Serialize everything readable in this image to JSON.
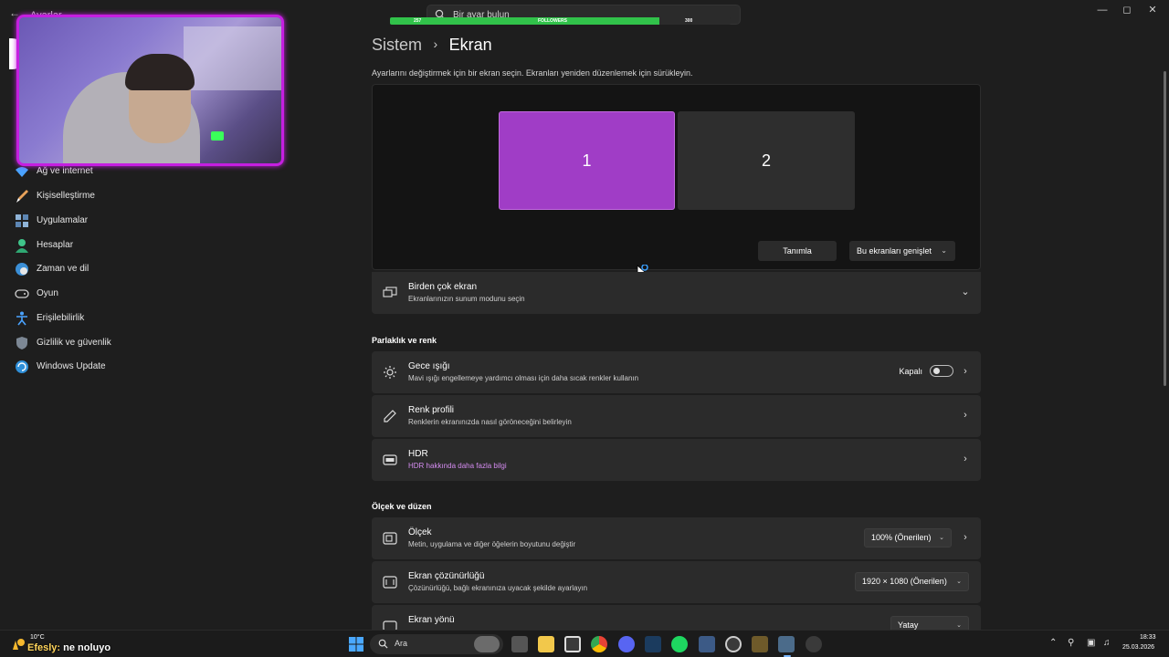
{
  "window": {
    "app_title": "Ayarlar",
    "search_placeholder": "Bir ayar bulun",
    "controls": {
      "minimize": "—",
      "maximize": "◻",
      "close": "✕"
    }
  },
  "follower_goal": {
    "current": "257",
    "label": "FOLLOWERS",
    "goal": "300",
    "progress": 0.79
  },
  "sidebar": {
    "items": [
      {
        "label": "Ağ ve internet",
        "icon": "wifi-icon"
      },
      {
        "label": "Kişiselleştirme",
        "icon": "brush-icon"
      },
      {
        "label": "Uygulamalar",
        "icon": "apps-icon"
      },
      {
        "label": "Hesaplar",
        "icon": "person-icon"
      },
      {
        "label": "Zaman ve dil",
        "icon": "globe-clock-icon"
      },
      {
        "label": "Oyun",
        "icon": "gamepad-icon"
      },
      {
        "label": "Erişilebilirlik",
        "icon": "accessibility-icon"
      },
      {
        "label": "Gizlilik ve güvenlik",
        "icon": "shield-icon"
      },
      {
        "label": "Windows Update",
        "icon": "update-icon"
      }
    ]
  },
  "main": {
    "breadcrumb_parent": "Sistem",
    "breadcrumb_sep": "›",
    "breadcrumb_current": "Ekran",
    "hint": "Ayarlarını değiştirmek için bir ekran seçin. Ekranları yeniden düzenlemek için sürükleyin.",
    "monitors": [
      "1",
      "2"
    ],
    "identify_label": "Tanımla",
    "extend_label": "Bu ekranları genişlet",
    "multiple_displays": {
      "title": "Birden çok ekran",
      "subtitle": "Ekranlarınızın sunum modunu seçin"
    },
    "section_brightness": "Parlaklık ve renk",
    "night_light": {
      "title": "Gece ışığı",
      "subtitle": "Mavi ışığı engellemeye yardımcı olması için daha sıcak renkler kullanın",
      "state": "Kapalı"
    },
    "color_profile": {
      "title": "Renk profili",
      "subtitle": "Renklerin ekranınızda nasıl göröneceğini belirleyin"
    },
    "hdr": {
      "title": "HDR",
      "link": "HDR hakkında daha fazla bilgi"
    },
    "section_scale": "Ölçek ve düzen",
    "scale": {
      "title": "Ölçek",
      "subtitle": "Metin, uygulama ve diğer öğelerin boyutunu değiştir",
      "value": "100% (Önerilen)"
    },
    "resolution": {
      "title": "Ekran çözünürlüğü",
      "subtitle": "Çözünürlüğü, bağlı ekranınıza uyacak şekilde ayarlayın",
      "value": "1920 × 1080 (Önerilen)"
    },
    "orientation": {
      "title": "Ekran yönü",
      "value": "Yatay"
    }
  },
  "overlay": {
    "chat_user": "Efesly:",
    "chat_text": "ne noluyo"
  },
  "taskbar": {
    "weather_temp": "10°C",
    "search_label": "Ara",
    "time": "18:33",
    "date": "25.03.2026"
  },
  "colors": {
    "accent": "#a03dc6",
    "cam_border": "#c51fe0",
    "goal_fill": "#31c24a",
    "link": "#d48cf0"
  }
}
